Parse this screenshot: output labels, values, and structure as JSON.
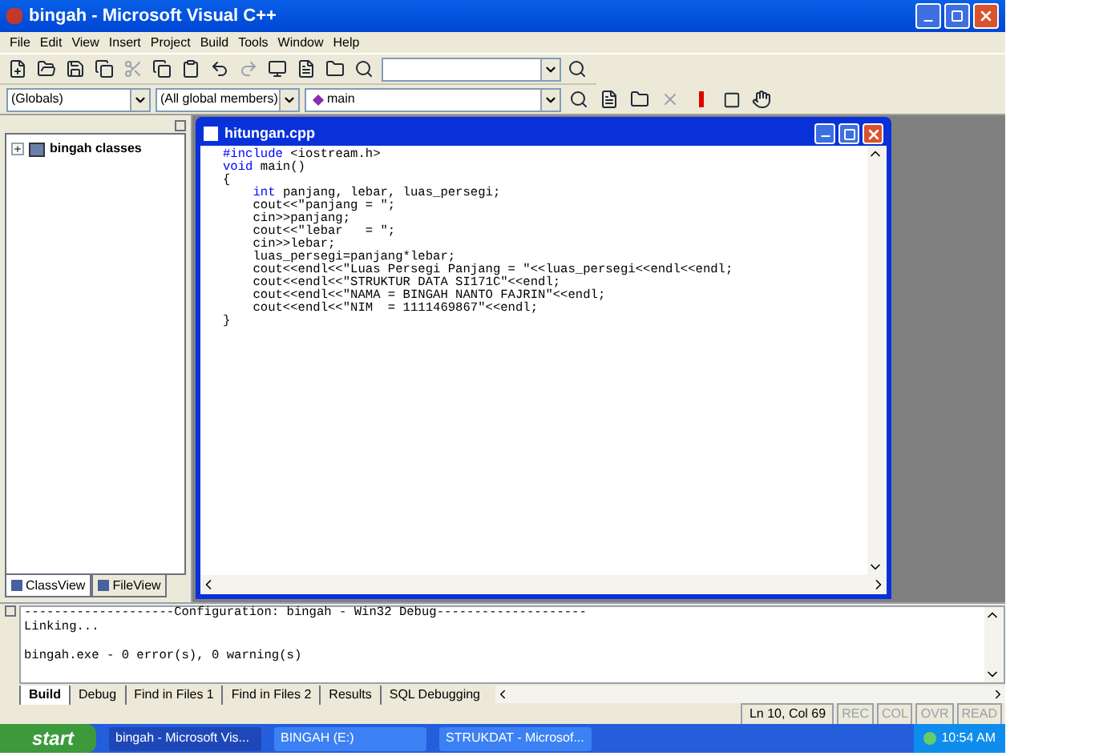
{
  "window": {
    "title": "bingah - Microsoft Visual C++"
  },
  "menu": [
    "File",
    "Edit",
    "View",
    "Insert",
    "Project",
    "Build",
    "Tools",
    "Window",
    "Help"
  ],
  "combos": {
    "scope": "(Globals)",
    "members": "(All global members)",
    "function": "main"
  },
  "workspace": {
    "tree": [
      {
        "label": "bingah classes",
        "expanded": false
      }
    ],
    "tabs": [
      {
        "label": "ClassView",
        "selected": true
      },
      {
        "label": "FileView",
        "selected": false
      }
    ]
  },
  "editor": {
    "title": "hitungan.cpp",
    "lines": [
      [
        {
          "text": "#include",
          "kind": "keyword"
        },
        {
          "text": " <iostream.h>",
          "kind": "plain"
        }
      ],
      [
        {
          "text": "void",
          "kind": "keyword"
        },
        {
          "text": " main()",
          "kind": "plain"
        }
      ],
      [
        {
          "text": "{",
          "kind": "plain"
        }
      ],
      [
        {
          "text": "    int",
          "kind": "keyword"
        },
        {
          "text": " panjang, lebar, luas_persegi;",
          "kind": "plain"
        }
      ],
      [
        {
          "text": "    cout<<\"panjang = \";",
          "kind": "plain"
        }
      ],
      [
        {
          "text": "    cin>>panjang;",
          "kind": "plain"
        }
      ],
      [
        {
          "text": "    cout<<\"lebar   = \";",
          "kind": "plain"
        }
      ],
      [
        {
          "text": "    cin>>lebar;",
          "kind": "plain"
        }
      ],
      [
        {
          "text": "    luas_persegi=panjang*lebar;",
          "kind": "plain"
        }
      ],
      [
        {
          "text": "    cout<<endl<<\"Luas Persegi Panjang = \"<<luas_persegi<<endl<<endl;",
          "kind": "plain"
        }
      ],
      [
        {
          "text": "    cout<<endl<<\"STRUKTUR DATA SI171C\"<<endl;",
          "kind": "plain"
        }
      ],
      [
        {
          "text": "    cout<<endl<<\"NAMA = BINGAH NANTO FAJRIN\"<<endl;",
          "kind": "plain"
        }
      ],
      [
        {
          "text": "    cout<<endl<<\"NIM  = 1111469867\"<<endl;",
          "kind": "plain"
        }
      ],
      [
        {
          "text": "}",
          "kind": "plain"
        }
      ]
    ]
  },
  "output": {
    "blocks": [
      [
        "--------------------Configuration: bingah - Win32 Debug--------------------",
        "Linking..."
      ],
      [
        "bingah.exe - 0 error(s), 0 warning(s)"
      ]
    ],
    "tabs": [
      {
        "label": "Build",
        "selected": true
      },
      {
        "label": "Debug",
        "selected": false
      },
      {
        "label": "Find in Files 1",
        "selected": false
      },
      {
        "label": "Find in Files 2",
        "selected": false
      },
      {
        "label": "Results",
        "selected": false
      },
      {
        "label": "SQL Debugging",
        "selected": false
      }
    ]
  },
  "status_bar": {
    "position": "Ln 10, Col 69",
    "indicators": [
      {
        "label": "REC",
        "disabled": true
      },
      {
        "label": "COL",
        "disabled": true
      },
      {
        "label": "OVR",
        "disabled": true
      },
      {
        "label": "READ",
        "disabled": true
      }
    ]
  },
  "taskbar": {
    "start": "start",
    "tasks": [
      {
        "label": "bingah - Microsoft Vis...",
        "selected": true
      },
      {
        "label": "BINGAH (E:)",
        "selected": false
      },
      {
        "label": "STRUKDAT - Microsof...",
        "selected": false
      }
    ],
    "clock": "10:54 AM"
  }
}
